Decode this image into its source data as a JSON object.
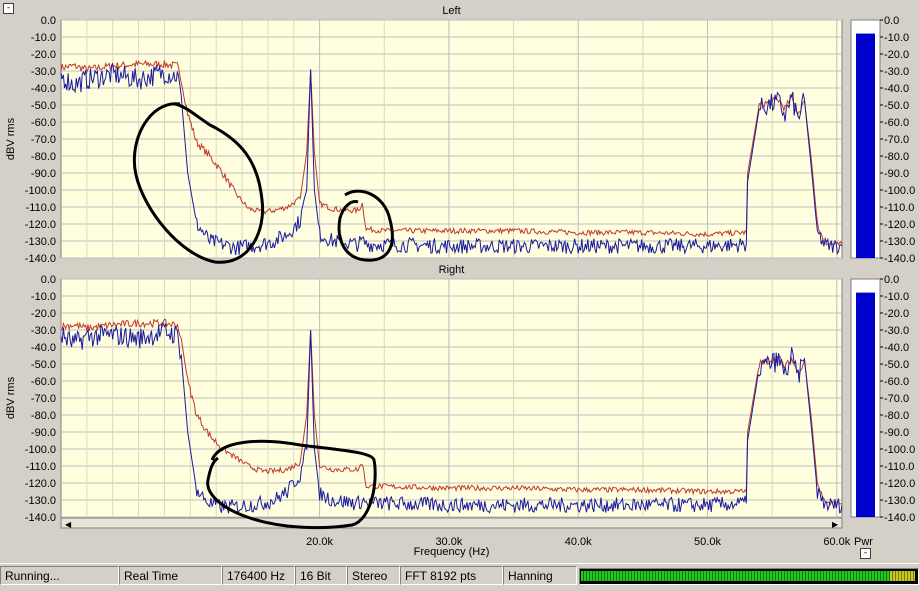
{
  "status": {
    "state": "Running...",
    "mode": "Real Time",
    "sample_rate": "176400 Hz",
    "bit_depth": "16 Bit",
    "channels": "Stereo",
    "fft_size": "FFT 8192 pts",
    "window": "Hanning",
    "level_meter_fraction": 0.92
  },
  "meter_label": "Pwr",
  "colors": {
    "plot_bg": "#ffffe0",
    "grid": "#bdbdbd",
    "series_red": "#c0392b",
    "series_blue": "#1a1aa0",
    "annotation": "#000000",
    "meter_bar": "#0000cc"
  },
  "chart_data": [
    {
      "type": "line",
      "title": "Left",
      "xlabel": "",
      "ylabel": "dBV rms",
      "xlim": [
        0,
        60400
      ],
      "ylim": [
        -140,
        0
      ],
      "x_ticks": [
        20000,
        30000,
        40000,
        50000,
        60000
      ],
      "x_tick_labels": [],
      "y_ticks": [
        0,
        -10,
        -20,
        -30,
        -40,
        -50,
        -60,
        -70,
        -80,
        -90,
        -100,
        -110,
        -120,
        -130,
        -140
      ],
      "y_tick_labels": [
        "0.0",
        "-10.0",
        "-20.0",
        "-30.0",
        "-40.0",
        "-50.0",
        "-60.0",
        "-70.0",
        "-80.0",
        "-90.0",
        "-100.0",
        "-110.0",
        "-120.0",
        "-130.0",
        "-140.0"
      ],
      "grid": true,
      "series": [
        {
          "color": "#c0392b",
          "x": [
            0,
            1000,
            2000,
            4000,
            6000,
            8000,
            9000,
            9300,
            9800,
            10500,
            11500,
            12500,
            13500,
            14500,
            15500,
            16500,
            17500,
            18500,
            19000,
            19300,
            19600,
            20000,
            21000,
            22000,
            23000,
            23300,
            23600,
            25000,
            30000,
            35000,
            40000,
            45000,
            50000,
            53000,
            53100,
            54000,
            55500,
            56000,
            56500,
            57000,
            57500,
            58000,
            58500,
            59000,
            59500,
            60400
          ],
          "y": [
            -28,
            -27,
            -29,
            -27,
            -26,
            -26,
            -27,
            -35,
            -55,
            -72,
            -80,
            -90,
            -102,
            -111,
            -113,
            -112,
            -110,
            -105,
            -78,
            -30,
            -78,
            -108,
            -111,
            -112,
            -112,
            -108,
            -123,
            -124,
            -124,
            -124,
            -125,
            -125,
            -126,
            -125,
            -90,
            -50,
            -47,
            -52,
            -46,
            -55,
            -48,
            -80,
            -120,
            -130,
            -132,
            -132
          ]
        },
        {
          "color": "#1a1aa0",
          "x": [
            0,
            1000,
            2000,
            4000,
            6000,
            8000,
            9000,
            9300,
            9800,
            10500,
            11500,
            12500,
            13500,
            14500,
            15500,
            16500,
            17500,
            18500,
            19000,
            19300,
            19600,
            20000,
            21000,
            22000,
            23000,
            23300,
            23600,
            25000,
            30000,
            35000,
            40000,
            45000,
            50000,
            53000,
            53100,
            54000,
            55500,
            56000,
            56500,
            57000,
            57500,
            58000,
            58500,
            59000,
            59500,
            60400
          ],
          "y": [
            -33,
            -38,
            -35,
            -32,
            -35,
            -31,
            -33,
            -45,
            -90,
            -120,
            -130,
            -132,
            -134,
            -133,
            -132,
            -130,
            -126,
            -118,
            -100,
            -29,
            -100,
            -126,
            -130,
            -131,
            -132,
            -130,
            -132,
            -132,
            -133,
            -133,
            -133,
            -133,
            -133,
            -132,
            -95,
            -52,
            -48,
            -56,
            -46,
            -58,
            -47,
            -85,
            -125,
            -132,
            -133,
            -133
          ]
        }
      ]
    },
    {
      "type": "line",
      "title": "Right",
      "xlabel": "Frequency (Hz)",
      "ylabel": "dBV rms",
      "xlim": [
        0,
        60400
      ],
      "ylim": [
        -140,
        0
      ],
      "x_ticks": [
        20000,
        30000,
        40000,
        50000,
        60000
      ],
      "x_tick_labels": [
        "20.0k",
        "30.0k",
        "40.0k",
        "50.0k",
        "60.0k"
      ],
      "y_ticks": [
        0,
        -10,
        -20,
        -30,
        -40,
        -50,
        -60,
        -70,
        -80,
        -90,
        -100,
        -110,
        -120,
        -130,
        -140
      ],
      "y_tick_labels": [
        "0.0",
        "-10.0",
        "-20.0",
        "-30.0",
        "-40.0",
        "-50.0",
        "-60.0",
        "-70.0",
        "-80.0",
        "-90.0",
        "-100.0",
        "-110.0",
        "-120.0",
        "-130.0",
        "-140.0"
      ],
      "grid": true,
      "series": [
        {
          "color": "#c0392b",
          "x": [
            0,
            1000,
            2000,
            4000,
            6000,
            8000,
            9000,
            9300,
            9800,
            10500,
            11500,
            12500,
            13500,
            14500,
            15500,
            16500,
            17500,
            18500,
            19000,
            19300,
            19600,
            20000,
            21000,
            22000,
            23000,
            23300,
            23600,
            25000,
            30000,
            35000,
            40000,
            45000,
            50000,
            53000,
            53100,
            54000,
            55500,
            56000,
            56500,
            57000,
            57500,
            58000,
            58500,
            59000,
            59500,
            60400
          ],
          "y": [
            -28,
            -27,
            -29,
            -27,
            -26,
            -26,
            -27,
            -35,
            -60,
            -80,
            -92,
            -100,
            -105,
            -110,
            -113,
            -113,
            -112,
            -108,
            -80,
            -30,
            -80,
            -110,
            -112,
            -112,
            -112,
            -108,
            -122,
            -122,
            -123,
            -123,
            -124,
            -124,
            -125,
            -125,
            -90,
            -50,
            -46,
            -52,
            -47,
            -55,
            -48,
            -80,
            -120,
            -130,
            -132,
            -132
          ]
        },
        {
          "color": "#1a1aa0",
          "x": [
            0,
            1000,
            2000,
            4000,
            6000,
            8000,
            9000,
            9300,
            9800,
            10500,
            11500,
            12500,
            13500,
            14500,
            15500,
            16500,
            17500,
            18500,
            19000,
            19300,
            19600,
            20000,
            21000,
            22000,
            23000,
            23300,
            23600,
            25000,
            30000,
            35000,
            40000,
            45000,
            50000,
            53000,
            53100,
            54000,
            55500,
            56000,
            56500,
            57000,
            57500,
            58000,
            58500,
            59000,
            59500,
            60400
          ],
          "y": [
            -33,
            -38,
            -34,
            -33,
            -35,
            -31,
            -33,
            -45,
            -90,
            -125,
            -132,
            -134,
            -134,
            -133,
            -132,
            -130,
            -125,
            -115,
            -100,
            -30,
            -100,
            -126,
            -130,
            -131,
            -132,
            -130,
            -132,
            -132,
            -133,
            -133,
            -133,
            -133,
            -133,
            -132,
            -95,
            -52,
            -48,
            -56,
            -46,
            -58,
            -47,
            -85,
            -125,
            -132,
            -133,
            -133
          ]
        }
      ]
    }
  ],
  "meters": [
    {
      "tick_labels": [
        "0.0",
        "-10.0",
        "-20.0",
        "-30.0",
        "-40.0",
        "-50.0",
        "-60.0",
        "-70.0",
        "-80.0",
        "-90.0",
        "-100.0",
        "-110.0",
        "-120.0",
        "-130.0",
        "-140.0"
      ],
      "level_db": -8
    },
    {
      "tick_labels": [
        "0.0",
        "-10.0",
        "-20.0",
        "-30.0",
        "-40.0",
        "-50.0",
        "-60.0",
        "-70.0",
        "-80.0",
        "-90.0",
        "-100.0",
        "-110.0",
        "-120.0",
        "-130.0",
        "-140.0"
      ],
      "level_db": -8
    }
  ]
}
